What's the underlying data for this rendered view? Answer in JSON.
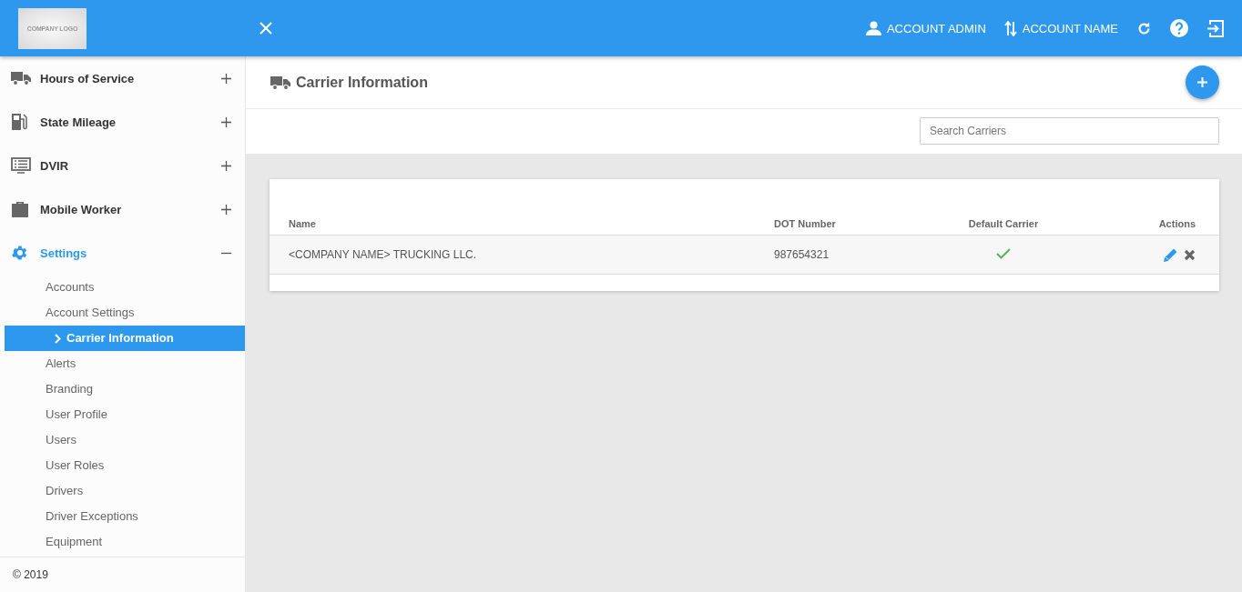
{
  "header": {
    "logo": "COMPANY LOGO",
    "user": "ACCOUNT ADMIN",
    "account": "ACCOUNT NAME"
  },
  "sidebar": {
    "items": [
      {
        "label": "Hours of Service",
        "kind": "truck",
        "expanded": false,
        "selected": false
      },
      {
        "label": "State Mileage",
        "kind": "fuel",
        "expanded": false,
        "selected": false
      },
      {
        "label": "DVIR",
        "kind": "list",
        "expanded": false,
        "selected": false
      },
      {
        "label": "Mobile Worker",
        "kind": "briefcase",
        "expanded": false,
        "selected": false
      },
      {
        "label": "Settings",
        "kind": "gear",
        "expanded": true,
        "selected": true,
        "children": [
          {
            "label": "Accounts",
            "selected": false
          },
          {
            "label": "Account Settings",
            "selected": false
          },
          {
            "label": "Carrier Information",
            "selected": true
          },
          {
            "label": "Alerts",
            "selected": false
          },
          {
            "label": "Branding",
            "selected": false
          },
          {
            "label": "User Profile",
            "selected": false
          },
          {
            "label": "Users",
            "selected": false
          },
          {
            "label": "User Roles",
            "selected": false
          },
          {
            "label": "Drivers",
            "selected": false
          },
          {
            "label": "Driver Exceptions",
            "selected": false
          },
          {
            "label": "Equipment",
            "selected": false
          }
        ]
      }
    ],
    "footer": "© 2019"
  },
  "page": {
    "title": "Carrier Information",
    "search": {
      "placeholder": "Search Carriers"
    },
    "table": {
      "columns": [
        "Name",
        "DOT Number",
        "Default Carrier",
        "Actions"
      ],
      "rows": [
        {
          "name": "<COMPANY NAME> TRUCKING LLC.",
          "dot_number": "987654321",
          "default_carrier": true
        }
      ]
    }
  }
}
